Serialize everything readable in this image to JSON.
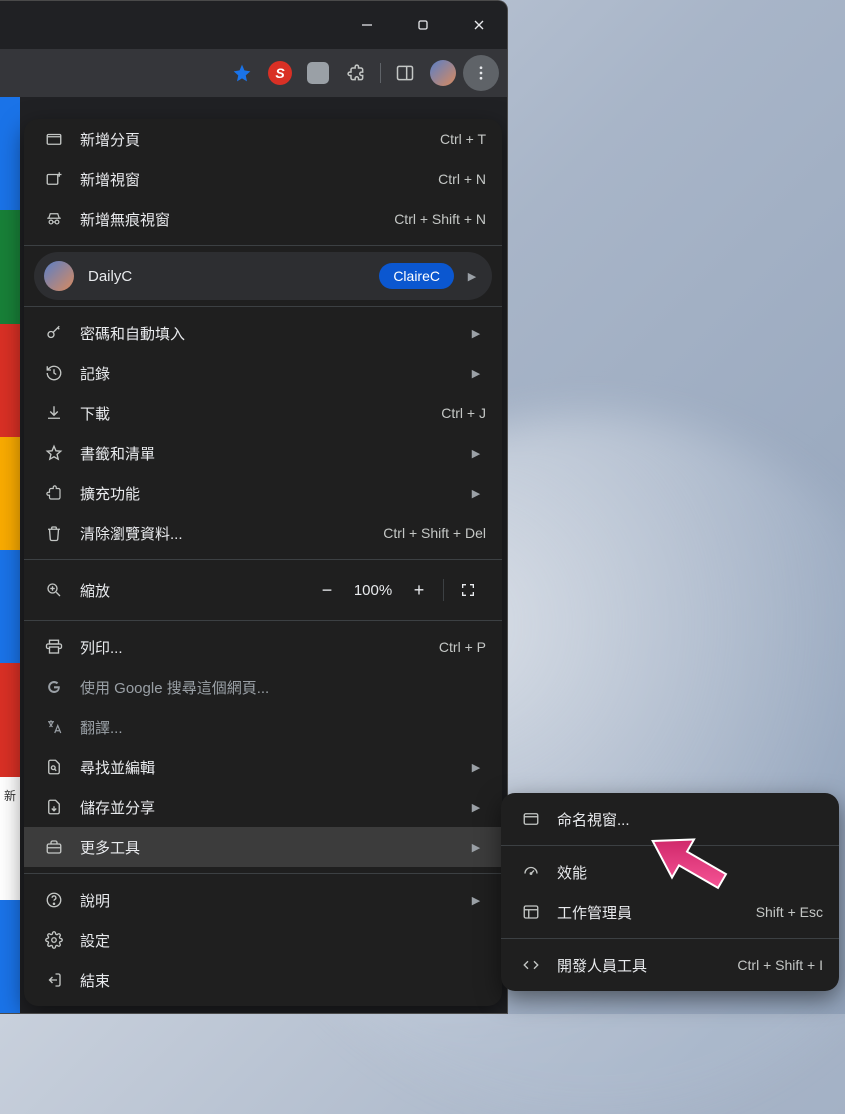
{
  "window": {
    "minimize": "–",
    "maximize": "▢",
    "close": "✕"
  },
  "toolbar": {
    "star_color": "#1a73e8",
    "ext_red_bg": "#d93025"
  },
  "menu": {
    "new_tab": {
      "label": "新增分頁",
      "shortcut": "Ctrl + T"
    },
    "new_window": {
      "label": "新增視窗",
      "shortcut": "Ctrl + N"
    },
    "new_incognito": {
      "label": "新增無痕視窗",
      "shortcut": "Ctrl + Shift + N"
    },
    "profile": {
      "name": "DailyC",
      "badge": "ClaireC"
    },
    "passwords": {
      "label": "密碼和自動填入"
    },
    "history": {
      "label": "記錄"
    },
    "downloads": {
      "label": "下載",
      "shortcut": "Ctrl + J"
    },
    "bookmarks": {
      "label": "書籤和清單"
    },
    "extensions": {
      "label": "擴充功能"
    },
    "clear_data": {
      "label": "清除瀏覽資料...",
      "shortcut": "Ctrl + Shift + Del"
    },
    "zoom": {
      "label": "縮放",
      "value": "100%"
    },
    "print": {
      "label": "列印...",
      "shortcut": "Ctrl + P"
    },
    "search_page": {
      "label": "使用 Google 搜尋這個網頁..."
    },
    "translate": {
      "label": "翻譯..."
    },
    "find_edit": {
      "label": "尋找並編輯"
    },
    "save_share": {
      "label": "儲存並分享"
    },
    "more_tools": {
      "label": "更多工具"
    },
    "help": {
      "label": "說明"
    },
    "settings": {
      "label": "設定"
    },
    "exit": {
      "label": "結束"
    }
  },
  "submenu": {
    "name_window": {
      "label": "命名視窗..."
    },
    "performance": {
      "label": "效能"
    },
    "task_manager": {
      "label": "工作管理員",
      "shortcut": "Shift + Esc"
    },
    "dev_tools": {
      "label": "開發人員工具",
      "shortcut": "Ctrl + Shift + I"
    }
  },
  "left_strip_colors": [
    "#1a73e8",
    "#188038",
    "#d93025",
    "#f9ab00",
    "#1a73e8",
    "#d93025",
    "#ffffff",
    "#1a73e8"
  ],
  "left_strip_text": "新"
}
